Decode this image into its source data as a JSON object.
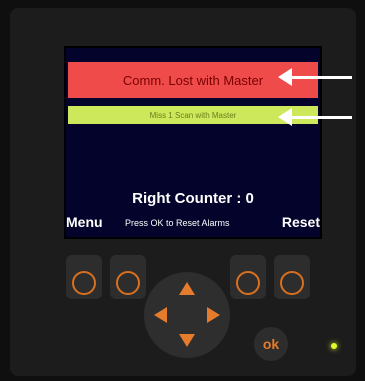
{
  "screen": {
    "alarm_text": "Comm. Lost with Master",
    "warning_text": "Miss 1 Scan with Master",
    "counter_text": "Right Counter : 0",
    "softkeys": {
      "left": "Menu",
      "center": "Press OK to Reset Alarms",
      "right": "Reset"
    }
  },
  "controls": {
    "ok_label": "ok"
  },
  "colors": {
    "alarm_bg": "#f04b4b",
    "warning_bg": "#cde85a",
    "screen_bg": "#03032b",
    "accent_orange": "#e47b2d",
    "led": "#e0ff2a"
  },
  "icons": {
    "arrows": "white-arrow-icon",
    "dpad": "directional-pad-icons",
    "led": "status-led"
  }
}
